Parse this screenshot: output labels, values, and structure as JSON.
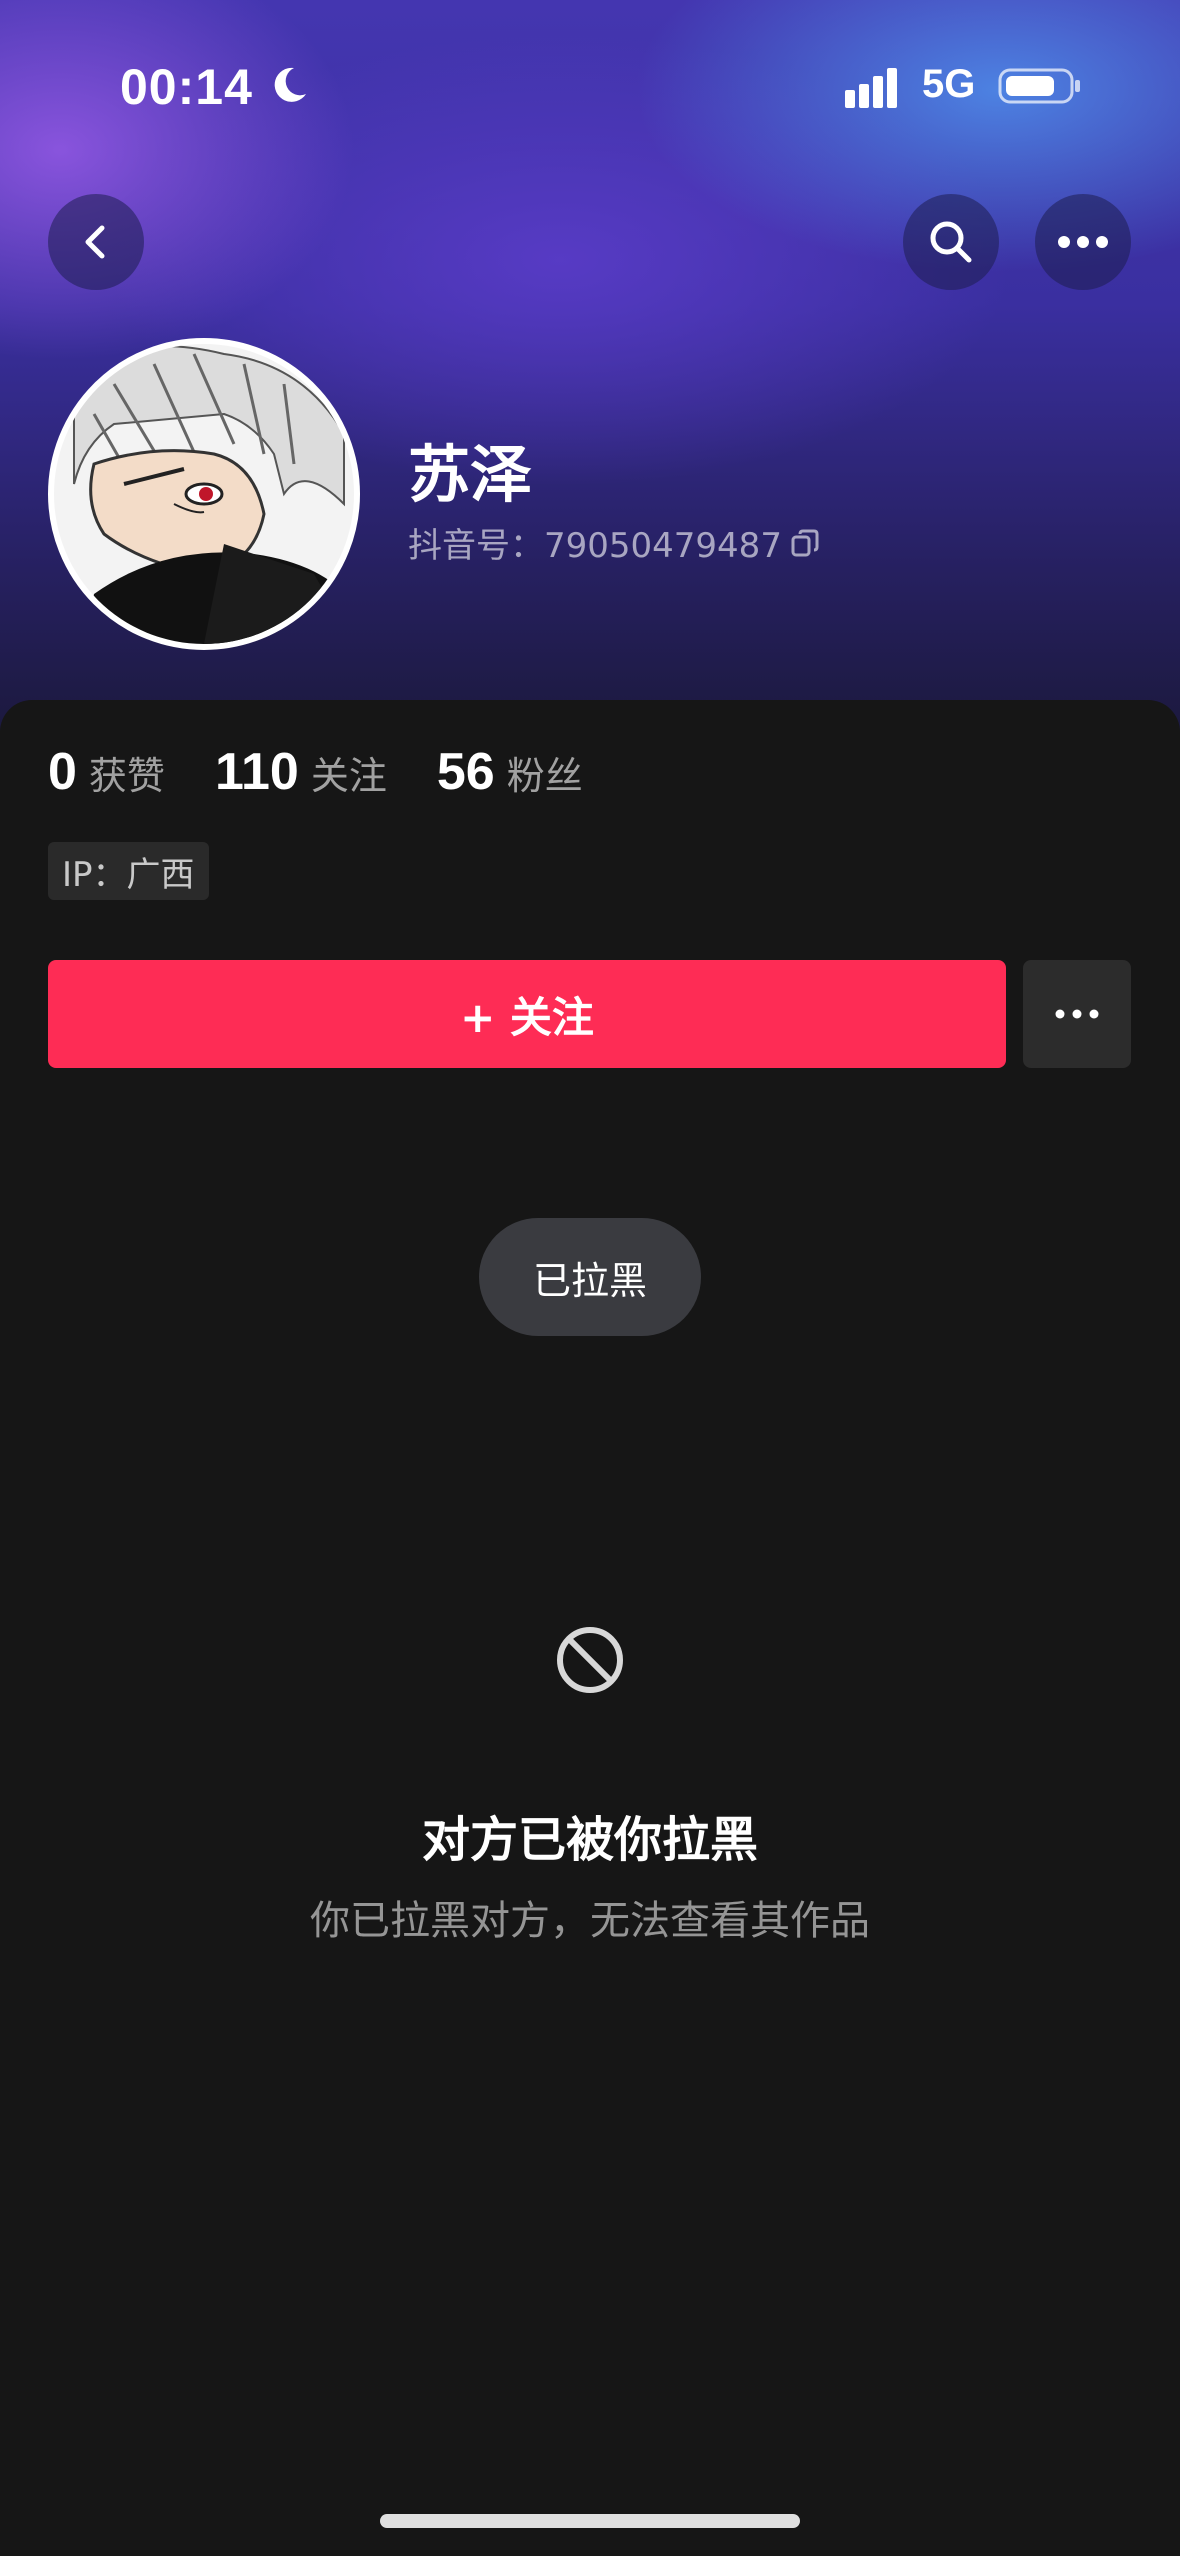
{
  "status_bar": {
    "time": "00:14",
    "network": "5G",
    "icons": [
      "moon-icon",
      "signal-icon",
      "battery-icon"
    ]
  },
  "header": {
    "back_icon": "chevron-left-icon",
    "search_icon": "search-icon",
    "more_icon": "more-horizontal-icon"
  },
  "profile": {
    "name": "苏泽",
    "douyin_id": "抖音号：79050479487",
    "copy_icon": "copy-icon"
  },
  "stats": [
    {
      "value": "0",
      "label": "获赞"
    },
    {
      "value": "110",
      "label": "关注"
    },
    {
      "value": "56",
      "label": "粉丝"
    }
  ],
  "ip": "IP：广西",
  "actions": {
    "follow_label": "+ 关注",
    "more_icon": "more-horizontal-icon"
  },
  "toast": "已拉黑",
  "empty_state": {
    "icon": "block-icon",
    "title": "对方已被你拉黑",
    "subtitle": "你已拉黑对方，无法查看其作品"
  },
  "colors": {
    "accent": "#fe2c55",
    "background": "#161616"
  }
}
